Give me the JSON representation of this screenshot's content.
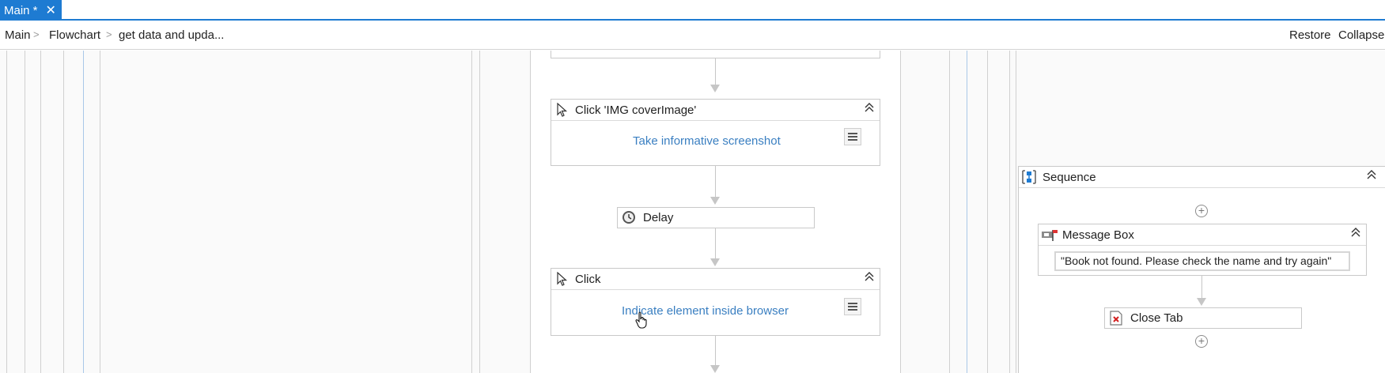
{
  "tabs": [
    {
      "label": "Main *",
      "close": "✕"
    }
  ],
  "breadcrumb": [
    "Main",
    "Flowchart",
    "get data and upda..."
  ],
  "breadcrumb_separator": ">",
  "toolbar": {
    "restore": "Restore",
    "collapse": "Collapse"
  },
  "activities": {
    "click_cover": {
      "title": "Click 'IMG  coverImage'",
      "link": "Take informative screenshot",
      "icon": "cursor-icon"
    },
    "delay": {
      "title": "Delay",
      "icon": "clock-icon"
    },
    "click": {
      "title": "Click",
      "link": "Indicate element inside browser",
      "icon": "cursor-icon"
    },
    "sequence": {
      "title": "Sequence",
      "icon": "sequence-icon"
    },
    "message_box": {
      "title": "Message Box",
      "value": "\"Book not found. Please check the name and try again\"",
      "icon": "message-box-icon"
    },
    "close_tab": {
      "title": "Close Tab",
      "icon": "close-tab-icon"
    }
  },
  "colors": {
    "accent": "#1e7bd2",
    "link": "#3a7fc1"
  }
}
